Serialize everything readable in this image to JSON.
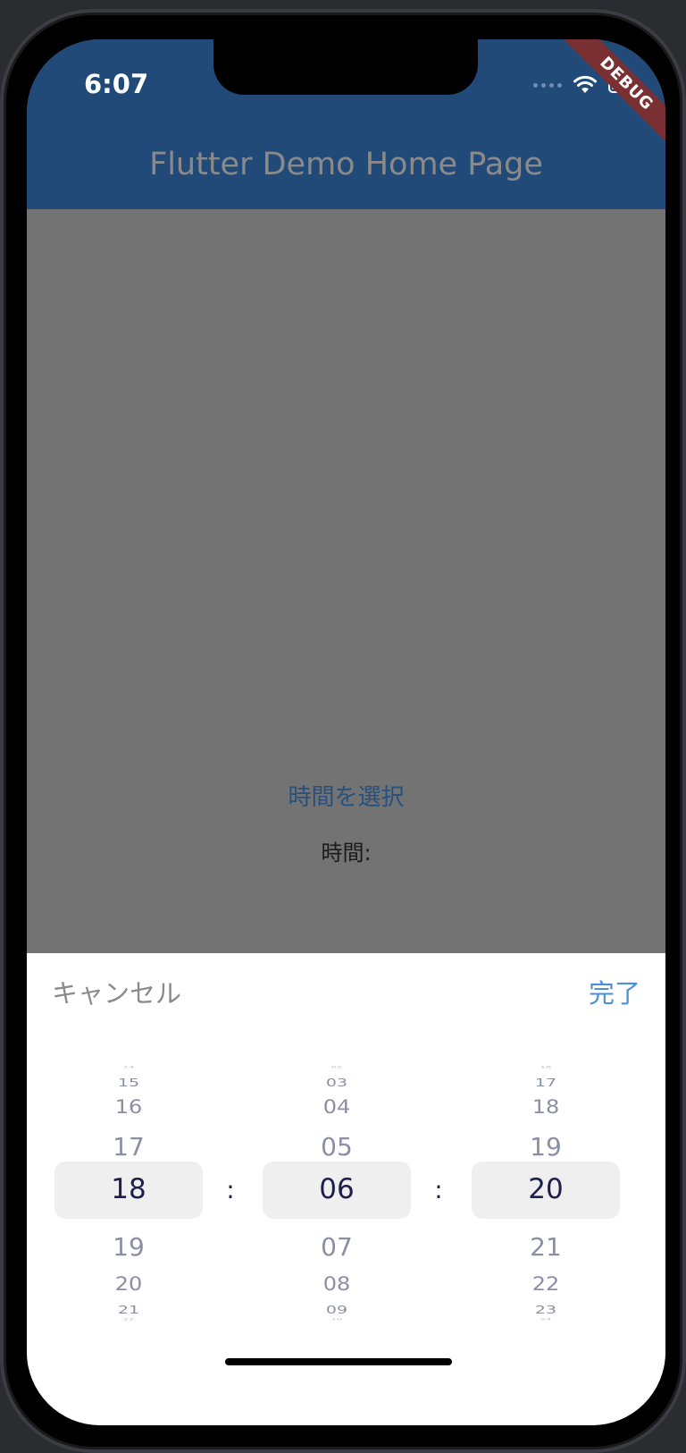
{
  "status_bar": {
    "time": "6:07"
  },
  "app_bar": {
    "title": "Flutter Demo Home Page",
    "debug_banner": "DEBUG",
    "color": "#214a78"
  },
  "content": {
    "select_time_button": "時間を選択",
    "time_label": "時間:"
  },
  "picker_sheet": {
    "cancel_label": "キャンセル",
    "done_label": "完了",
    "separator": ":",
    "hours": [
      "14",
      "15",
      "16",
      "17",
      "18",
      "19",
      "20",
      "21",
      "22"
    ],
    "minutes": [
      "02",
      "03",
      "04",
      "05",
      "06",
      "07",
      "08",
      "09",
      "10"
    ],
    "seconds": [
      "16",
      "17",
      "18",
      "19",
      "20",
      "21",
      "22",
      "23",
      "24"
    ],
    "selected": {
      "hour": "18",
      "minute": "06",
      "second": "20"
    }
  }
}
